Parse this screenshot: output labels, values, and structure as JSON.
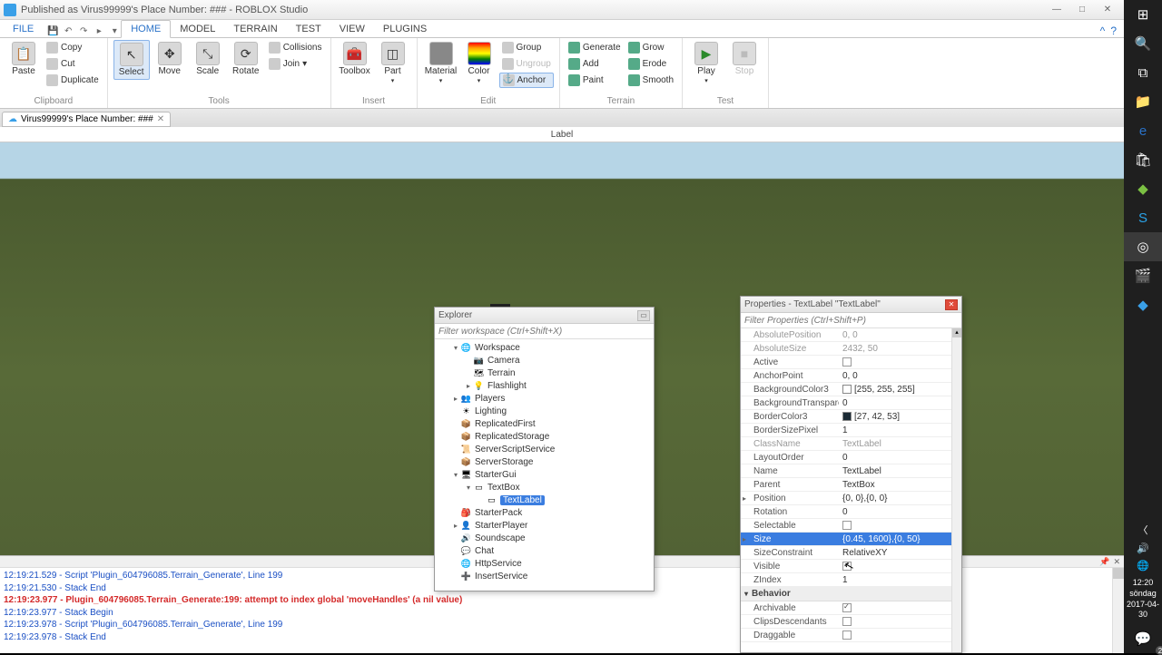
{
  "titlebar": {
    "text": "Published as Virus99999's Place Number: ### - ROBLOX Studio"
  },
  "ribbon_tabs": {
    "file": "FILE",
    "tabs": [
      "HOME",
      "MODEL",
      "TERRAIN",
      "TEST",
      "VIEW",
      "PLUGINS"
    ],
    "active": 0
  },
  "ribbon": {
    "clipboard": {
      "label": "Clipboard",
      "paste": "Paste",
      "copy": "Copy",
      "cut": "Cut",
      "duplicate": "Duplicate"
    },
    "tools": {
      "label": "Tools",
      "select": "Select",
      "move": "Move",
      "scale": "Scale",
      "rotate": "Rotate",
      "collisions": "Collisions",
      "join": "Join"
    },
    "insert": {
      "label": "Insert",
      "toolbox": "Toolbox",
      "part": "Part"
    },
    "edit": {
      "label": "Edit",
      "material": "Material",
      "color": "Color",
      "group": "Group",
      "ungroup": "Ungroup",
      "anchor": "Anchor"
    },
    "terrain": {
      "label": "Terrain",
      "generate": "Generate",
      "add": "Add",
      "paint": "Paint",
      "grow": "Grow",
      "erode": "Erode",
      "smooth": "Smooth"
    },
    "test": {
      "label": "Test",
      "play": "Play",
      "stop": "Stop"
    }
  },
  "doc_tab": {
    "label": "Virus99999's Place Number: ###"
  },
  "viewport_tab": "Label",
  "explorer": {
    "title": "Explorer",
    "filter_placeholder": "Filter workspace (Ctrl+Shift+X)",
    "items": [
      {
        "label": "Workspace",
        "icon": "🌐",
        "indent": 1,
        "exp": "▾"
      },
      {
        "label": "Camera",
        "icon": "📷",
        "indent": 2
      },
      {
        "label": "Terrain",
        "icon": "🗺",
        "indent": 2
      },
      {
        "label": "Flashlight",
        "icon": "💡",
        "indent": 2,
        "exp": "▸"
      },
      {
        "label": "Players",
        "icon": "👥",
        "indent": 1,
        "exp": "▸"
      },
      {
        "label": "Lighting",
        "icon": "☀",
        "indent": 1
      },
      {
        "label": "ReplicatedFirst",
        "icon": "📦",
        "indent": 1
      },
      {
        "label": "ReplicatedStorage",
        "icon": "📦",
        "indent": 1
      },
      {
        "label": "ServerScriptService",
        "icon": "📜",
        "indent": 1
      },
      {
        "label": "ServerStorage",
        "icon": "📦",
        "indent": 1
      },
      {
        "label": "StarterGui",
        "icon": "🖥",
        "indent": 1,
        "exp": "▾"
      },
      {
        "label": "TextBox",
        "icon": "▭",
        "indent": 2,
        "exp": "▾"
      },
      {
        "label": "TextLabel",
        "icon": "▭",
        "indent": 3,
        "selected": true
      },
      {
        "label": "StarterPack",
        "icon": "🎒",
        "indent": 1
      },
      {
        "label": "StarterPlayer",
        "icon": "👤",
        "indent": 1,
        "exp": "▸"
      },
      {
        "label": "Soundscape",
        "icon": "🔊",
        "indent": 1
      },
      {
        "label": "Chat",
        "icon": "💬",
        "indent": 1
      },
      {
        "label": "HttpService",
        "icon": "🌐",
        "indent": 1
      },
      {
        "label": "InsertService",
        "icon": "➕",
        "indent": 1
      }
    ]
  },
  "properties": {
    "title": "Properties - TextLabel \"TextLabel\"",
    "filter_placeholder": "Filter Properties (Ctrl+Shift+P)",
    "rows": [
      {
        "name": "AbsolutePosition",
        "val": "0, 0",
        "readonly": true
      },
      {
        "name": "AbsoluteSize",
        "val": "2432, 50",
        "readonly": true
      },
      {
        "name": "Active",
        "val": "",
        "check": false
      },
      {
        "name": "AnchorPoint",
        "val": "0, 0"
      },
      {
        "name": "BackgroundColor3",
        "val": "[255, 255, 255]",
        "swatch": "#ffffff"
      },
      {
        "name": "BackgroundTransparency",
        "val": "0"
      },
      {
        "name": "BorderColor3",
        "val": "[27, 42, 53]",
        "swatch": "#1b2a35"
      },
      {
        "name": "BorderSizePixel",
        "val": "1"
      },
      {
        "name": "ClassName",
        "val": "TextLabel",
        "readonly": true
      },
      {
        "name": "LayoutOrder",
        "val": "0"
      },
      {
        "name": "Name",
        "val": "TextLabel"
      },
      {
        "name": "Parent",
        "val": "TextBox"
      },
      {
        "name": "Position",
        "val": "{0, 0},{0, 0}",
        "exp": "▸"
      },
      {
        "name": "Rotation",
        "val": "0"
      },
      {
        "name": "Selectable",
        "val": "",
        "check": false
      },
      {
        "name": "Size",
        "val": "{0.45, 1600},{0, 50}",
        "selected": true,
        "exp": "▸"
      },
      {
        "name": "SizeConstraint",
        "val": "RelativeXY"
      },
      {
        "name": "Visible",
        "val": "",
        "check": true
      },
      {
        "name": "ZIndex",
        "val": "1"
      }
    ],
    "behavior_cat": "Behavior",
    "behavior_rows": [
      {
        "name": "Archivable",
        "val": "",
        "check": true
      },
      {
        "name": "ClipsDescendants",
        "val": "",
        "check": false
      },
      {
        "name": "Draggable",
        "val": "",
        "check": false
      }
    ]
  },
  "output": {
    "lines": [
      {
        "cls": "blue",
        "text": "12:19:21.529 - Script 'Plugin_604796085.Terrain_Generate', Line 199"
      },
      {
        "cls": "blue",
        "text": "12:19:21.530 - Stack End"
      },
      {
        "cls": "red",
        "text": "12:19:23.977 - Plugin_604796085.Terrain_Generate:199: attempt to index global 'moveHandles' (a nil value)"
      },
      {
        "cls": "blue",
        "text": "12:19:23.977 - Stack Begin"
      },
      {
        "cls": "blue",
        "text": "12:19:23.978 - Script 'Plugin_604796085.Terrain_Generate', Line 199"
      },
      {
        "cls": "blue",
        "text": "12:19:23.978 - Stack End"
      }
    ]
  },
  "win_clock": {
    "time": "12:20",
    "day": "söndag",
    "date": "2017-04-30"
  }
}
